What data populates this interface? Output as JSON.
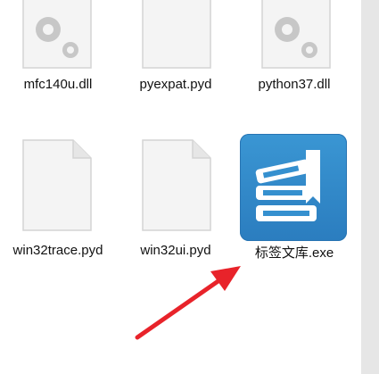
{
  "files": [
    {
      "name": "mfc140u.dll",
      "type": "dll"
    },
    {
      "name": "pyexpat.pyd",
      "type": "pyd"
    },
    {
      "name": "python37.dll",
      "type": "dll"
    },
    {
      "name": "win32trace.pyd",
      "type": "pyd"
    },
    {
      "name": "win32ui.pyd",
      "type": "pyd"
    },
    {
      "name": "标签文库.exe",
      "type": "exe"
    }
  ],
  "colors": {
    "arrow": "#e8232a",
    "app_icon": "#3590cf",
    "scrollbar": "#e6e6e6"
  },
  "icons": {
    "dll": "gears-document-icon",
    "pyd": "blank-document-icon",
    "exe": "books-app-icon"
  }
}
